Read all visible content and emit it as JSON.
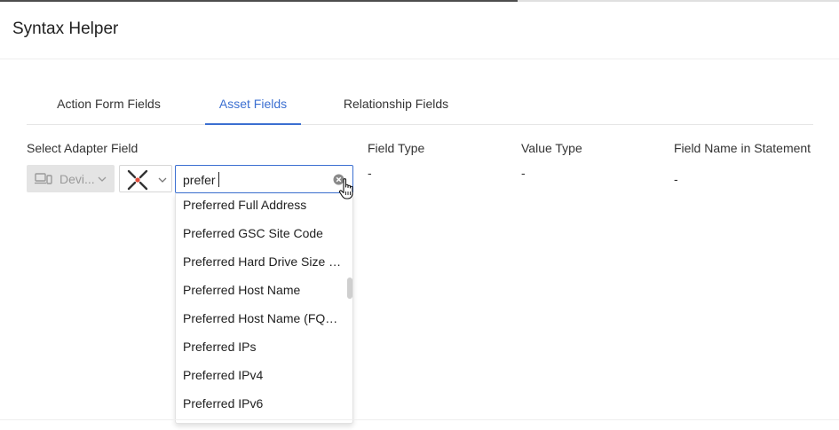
{
  "progress": {
    "fraction": 0.617,
    "color": "#4d4d4d"
  },
  "header": {
    "title": "Syntax Helper"
  },
  "tabs": [
    {
      "label": "Action Form Fields",
      "active": false
    },
    {
      "label": "Asset Fields",
      "active": true
    },
    {
      "label": "Relationship Fields",
      "active": false
    }
  ],
  "columns": {
    "select_adapter_field": "Select Adapter Field",
    "field_type": "Field Type",
    "value_type": "Value Type",
    "field_name_in_statement": "Field Name in Statement"
  },
  "values": {
    "field_type": "-",
    "value_type": "-",
    "field_name_in_statement": "-"
  },
  "adapter_select": {
    "icon": "device-icon",
    "label": "Devi..."
  },
  "entity_select": {
    "icon": "adapter-logo-icon"
  },
  "search": {
    "value": "prefer",
    "clear_icon": "clear-icon"
  },
  "dropdown": {
    "items": [
      "Preferred Full Address",
      "Preferred GSC Site Code",
      "Preferred Hard Drive Size (…",
      "Preferred Host Name",
      "Preferred Host Name (FQD…",
      "Preferred IPs",
      "Preferred IPv4",
      "Preferred IPv6"
    ]
  },
  "colors": {
    "accent": "#3b6fd1",
    "select_bg": "#e4e4e4",
    "logo_accent": "#e04b3a"
  }
}
